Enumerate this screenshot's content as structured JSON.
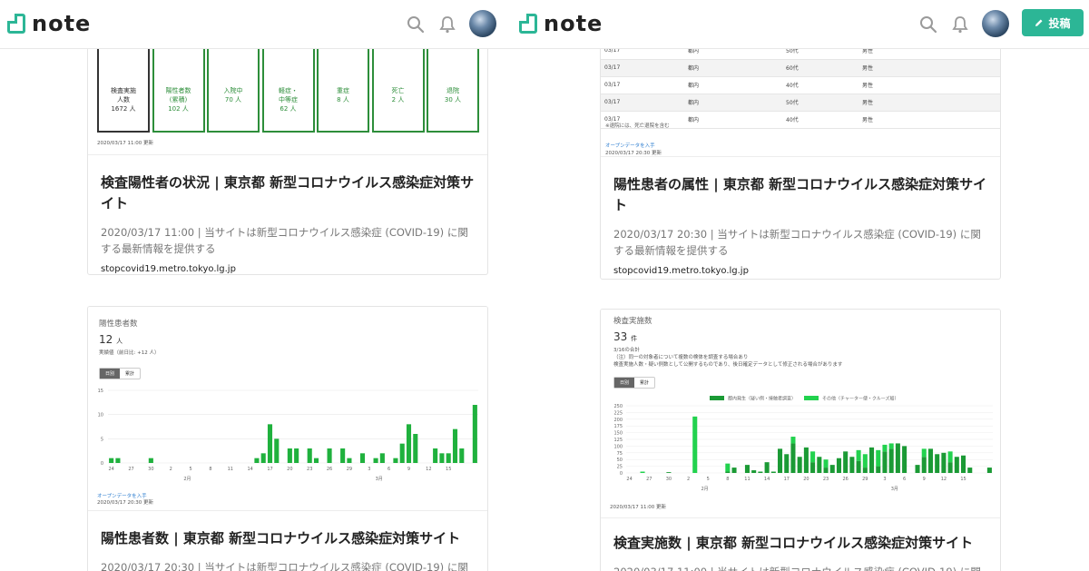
{
  "app": {
    "logo_text": "note",
    "post_label": "投稿",
    "brand_color": "#2cb696",
    "chart_green": "#1fb13d"
  },
  "cards": [
    {
      "title": "検査陽性者の状況 | 東京都 新型コロナウイルス感染症対策サイト",
      "desc": "2020/03/17 11:00 | 当サイトは新型コロナウイルス感染症 (COVID-19) に関する最新情報を提供する",
      "host": "stopcovid19.metro.tokyo.lg.jp",
      "image": {
        "boxes": [
          {
            "l1": "検査実施",
            "l2": "人数",
            "value": "1672 人"
          },
          {
            "l1": "陽性者数",
            "l2": "(累積)",
            "value": "102 人"
          },
          {
            "l1": "入院中",
            "l2": "",
            "value": "70 人"
          },
          {
            "l1": "軽症・",
            "l2": "中等症",
            "value": "62 人"
          },
          {
            "l1": "重症",
            "l2": "",
            "value": "8 人"
          },
          {
            "l1": "死亡",
            "l2": "",
            "value": "2 人"
          },
          {
            "l1": "退院",
            "l2": "",
            "value": "30 人"
          }
        ],
        "updated": "2020/03/17 11:00 更新"
      }
    },
    {
      "title": "陽性患者の属性 | 東京都 新型コロナウイルス感染症対策サイト",
      "desc": "2020/03/17 20:30 | 当サイトは新型コロナウイルス感染症 (COVID-19) に関する最新情報を提供する",
      "host": "stopcovid19.metro.tokyo.lg.jp",
      "image": {
        "rows": [
          [
            "03/17",
            "都内",
            "50代",
            "男性"
          ],
          [
            "03/17",
            "都内",
            "60代",
            "男性"
          ],
          [
            "03/17",
            "都内",
            "40代",
            "男性"
          ],
          [
            "03/17",
            "都内",
            "50代",
            "男性"
          ],
          [
            "03/17",
            "都内",
            "40代",
            "男性"
          ]
        ],
        "note": "※退院には、死亡退院を含む",
        "open_data": "オープンデータを入手",
        "updated": "2020/03/17 20:30 更新"
      }
    },
    {
      "title": "陽性患者数 | 東京都 新型コロナウイルス感染症対策サイト",
      "desc": "2020/03/17 20:30 | 当サイトは新型コロナウイルス感染症 (COVID-19) に関する最新情報を提供する",
      "image": {
        "heading": "陽性患者数",
        "big_value": "12",
        "big_unit": "人",
        "sub": "実績値（前日比: +12 人）",
        "toggle": [
          "日別",
          "累計"
        ],
        "open_data": "オープンデータを入手",
        "updated": "2020/03/17 20:30 更新"
      }
    },
    {
      "title": "検査実施数 | 東京都 新型コロナウイルス感染症対策サイト",
      "desc": "2020/03/17 11:00 | 当サイトは新型コロナウイルス感染症 (COVID-19) に関する最新情報を提供する",
      "image": {
        "heading": "検査実施数",
        "big_value": "33",
        "big_unit": "件",
        "sub": "3/16の合計",
        "note1": "（注）同一の対象者について複数の検体を調査する場合あり",
        "note2": "検査実施人数・疑い例数として公開するものであり、後日確定データとして修正される場合があります",
        "toggle": [
          "日別",
          "累計"
        ],
        "updated": "2020/03/17 11:00 更新"
      }
    }
  ],
  "chart_data": [
    {
      "type": "bar",
      "title": "陽性患者数",
      "x_ticks": [
        "24",
        "27",
        "30",
        "2",
        "5",
        "8",
        "11",
        "14",
        "17",
        "20",
        "23",
        "26",
        "29",
        "3",
        "6",
        "9",
        "12",
        "15"
      ],
      "month_labels": [
        "2月",
        "3月"
      ],
      "yticks": [
        "0",
        "5",
        "10",
        "15"
      ],
      "ylim": [
        0,
        15
      ],
      "values": [
        1,
        1,
        0,
        0,
        0,
        0,
        1,
        0,
        0,
        0,
        0,
        0,
        0,
        0,
        0,
        0,
        0,
        0,
        0,
        0,
        0,
        0,
        1,
        2,
        8,
        5,
        0,
        3,
        3,
        0,
        3,
        1,
        0,
        3,
        0,
        3,
        1,
        0,
        2,
        0,
        1,
        2,
        0,
        1,
        4,
        8,
        6,
        0,
        0,
        3,
        2,
        2,
        7,
        3,
        0,
        12
      ]
    },
    {
      "type": "bar",
      "title": "検査実施数",
      "legend": [
        "都内発生（疑い例・接触者調査）",
        "その他（チャーター便・クルーズ船）"
      ],
      "x_ticks": [
        "24",
        "27",
        "30",
        "2",
        "5",
        "8",
        "11",
        "14",
        "17",
        "20",
        "23",
        "26",
        "29",
        "3",
        "6",
        "9",
        "12",
        "15"
      ],
      "month_labels": [
        "2月",
        "3月"
      ],
      "yticks": [
        "0",
        "25",
        "50",
        "75",
        "100",
        "125",
        "150",
        "175",
        "200",
        "225",
        "250"
      ],
      "ylim": [
        0,
        250
      ],
      "series": [
        {
          "name": "都内発生（疑い例・接触者調査）",
          "values": [
            0,
            0,
            0,
            0,
            0,
            0,
            3,
            0,
            0,
            0,
            0,
            0,
            0,
            0,
            0,
            5,
            20,
            0,
            30,
            10,
            5,
            40,
            5,
            90,
            70,
            110,
            60,
            95,
            40,
            60,
            20,
            30,
            55,
            80,
            60,
            45,
            20,
            95,
            25,
            80,
            90,
            110,
            100,
            0,
            30,
            60,
            90,
            70,
            75,
            40,
            60,
            65,
            20,
            0,
            0,
            20
          ]
        },
        {
          "name": "その他（チャーター便・クルーズ船）",
          "values": [
            0,
            0,
            5,
            0,
            0,
            0,
            0,
            0,
            0,
            0,
            210,
            0,
            0,
            0,
            0,
            30,
            0,
            0,
            0,
            0,
            0,
            0,
            0,
            0,
            0,
            25,
            0,
            0,
            40,
            0,
            30,
            0,
            0,
            0,
            0,
            40,
            50,
            0,
            60,
            25,
            20,
            0,
            0,
            0,
            0,
            30,
            0,
            0,
            0,
            40,
            0,
            0,
            0,
            0,
            0,
            0
          ]
        }
      ]
    }
  ]
}
